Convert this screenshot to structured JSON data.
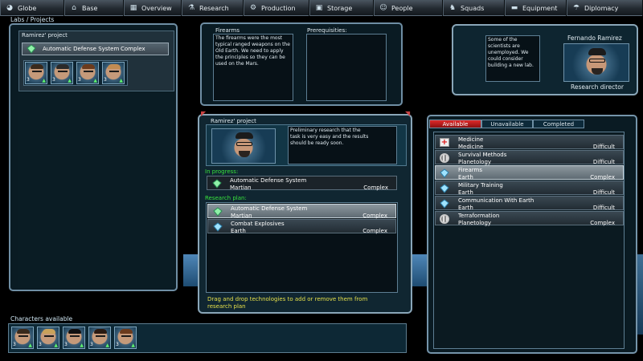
{
  "nav": [
    {
      "label": "Globe",
      "icon": "globe-icon",
      "glyph": "◕"
    },
    {
      "label": "Base",
      "icon": "base-icon",
      "glyph": "⌂"
    },
    {
      "label": "Overview",
      "icon": "overview-icon",
      "glyph": "▦"
    },
    {
      "label": "Research",
      "icon": "research-icon",
      "glyph": "⚗"
    },
    {
      "label": "Production",
      "icon": "production-icon",
      "glyph": "⚙"
    },
    {
      "label": "Storage",
      "icon": "storage-icon",
      "glyph": "▣"
    },
    {
      "label": "People",
      "icon": "people-icon",
      "glyph": "☺"
    },
    {
      "label": "Squads",
      "icon": "squads-icon",
      "glyph": "♞"
    },
    {
      "label": "Equipment",
      "icon": "equipment-icon",
      "glyph": "▬"
    },
    {
      "label": "Diplomacy",
      "icon": "diplomacy-icon",
      "glyph": "☂"
    }
  ],
  "labs": {
    "title": "Labs / Projects",
    "project_name": "Ramirez' project",
    "project_item": {
      "name": "Automatic Defense System",
      "complexity": "Complex"
    },
    "scientists": [
      {
        "level": "3"
      },
      {
        "level": "3"
      },
      {
        "level": "3"
      },
      {
        "level": "3"
      }
    ]
  },
  "tech_info": {
    "title": "Firearms",
    "description": "The firearms were the most typical ranged weapons on the Old Earth. We need to apply the principles so they can be used on the Mars.",
    "prerequisites_label": "Prerequisities:"
  },
  "director": {
    "message": "Some of the scientists are unemployed. We could consider building a new lab.",
    "name": "Fernando Ramirez",
    "role": "Research director"
  },
  "project": {
    "title": "Ramirez' project",
    "description": "Preliminary research that the task is very easy and the results should be ready soon.",
    "in_progress_label": "In progress:",
    "in_progress": {
      "name": "Automatic Defense System",
      "field": "Martian",
      "complexity": "Complex"
    },
    "plan_label": "Research plan:",
    "plan": [
      {
        "name": "Automatic Defense System",
        "field": "Martian",
        "complexity": "Complex"
      },
      {
        "name": "Combat Explosives",
        "field": "Earth",
        "complexity": "Complex"
      }
    ],
    "hint": "Drag and drop technologies to add or remove them from research plan"
  },
  "techlist": {
    "tabs": [
      "Available",
      "Unavailable",
      "Completed"
    ],
    "items": [
      {
        "name": "Medicine",
        "field": "Medicine",
        "difficulty": "Difficult",
        "icon": "medicine-icon"
      },
      {
        "name": "Survival Methods",
        "field": "Planetology",
        "difficulty": "Difficult",
        "icon": "planetology-icon"
      },
      {
        "name": "Firearms",
        "field": "Earth",
        "difficulty": "Complex",
        "icon": "earth-gem-icon"
      },
      {
        "name": "Military Training",
        "field": "Earth",
        "difficulty": "Difficult",
        "icon": "earth-gem-icon"
      },
      {
        "name": "Communication With Earth",
        "field": "Earth",
        "difficulty": "Difficult",
        "icon": "earth-gem-icon"
      },
      {
        "name": "Terraformation",
        "field": "Planetology",
        "difficulty": "Complex",
        "icon": "planetology-icon"
      }
    ]
  },
  "characters": {
    "title": "Characters available",
    "list": [
      {
        "level": "3"
      },
      {
        "level": "3"
      },
      {
        "level": "3"
      },
      {
        "level": "3"
      },
      {
        "level": "3"
      }
    ]
  }
}
